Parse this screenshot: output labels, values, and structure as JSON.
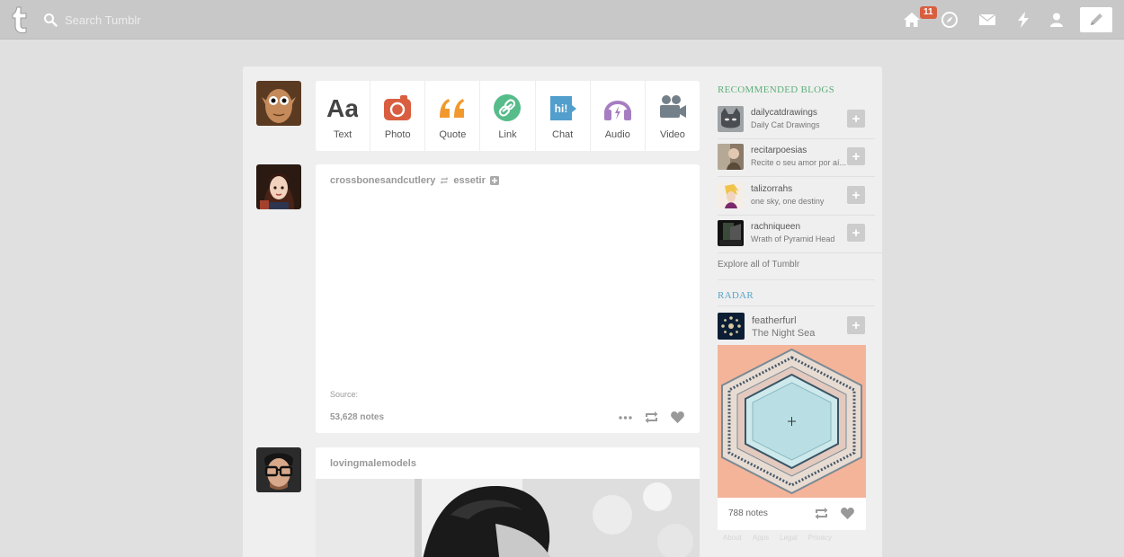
{
  "topbar": {
    "search_placeholder": "Search Tumblr",
    "home_badge": "11"
  },
  "post_types": [
    {
      "label": "Text",
      "icon": "text-icon",
      "color": "#444444"
    },
    {
      "label": "Photo",
      "icon": "camera-icon",
      "color": "#d95e40"
    },
    {
      "label": "Quote",
      "icon": "quote-icon",
      "color": "#f2992e"
    },
    {
      "label": "Link",
      "icon": "link-icon",
      "color": "#56bc8a"
    },
    {
      "label": "Chat",
      "icon": "chat-icon",
      "color": "#529ecc"
    },
    {
      "label": "Audio",
      "icon": "headphones-icon",
      "color": "#a77dc2"
    },
    {
      "label": "Video",
      "icon": "video-camera-icon",
      "color": "#748089"
    }
  ],
  "posts": [
    {
      "author": "crossbonesandcutlery",
      "reblogged_from": "essetir",
      "source_label": "Source:",
      "notes": "53,628 notes"
    },
    {
      "author": "lovingmalemodels"
    }
  ],
  "sidebar": {
    "recommended_title": "RECOMMENDED BLOGS",
    "blogs": [
      {
        "name": "dailycatdrawings",
        "desc": "Daily Cat Drawings"
      },
      {
        "name": "recitarpoesias",
        "desc": "Recite o seu amor por aí..."
      },
      {
        "name": "talizorrahs",
        "desc": "one sky, one destiny"
      },
      {
        "name": "rachniqueen",
        "desc": "Wrath of Pyramid Head"
      }
    ],
    "explore": "Explore all of Tumblr",
    "radar_title": "RADAR",
    "radar": {
      "name": "featherfurl",
      "desc": "The Night Sea",
      "notes": "788 notes"
    },
    "footer_links": [
      "About",
      "Apps",
      "Legal",
      "Privacy"
    ]
  }
}
